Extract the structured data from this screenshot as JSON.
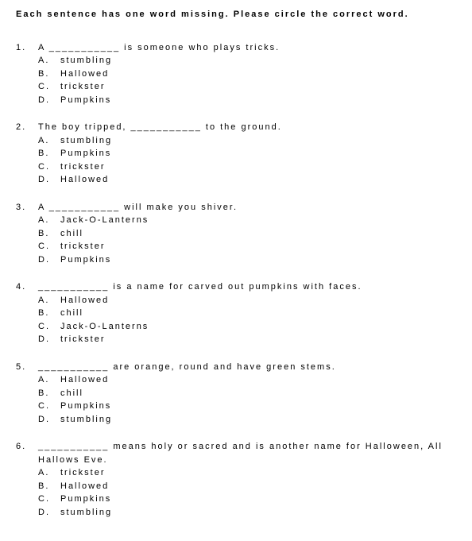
{
  "instructions": "Each sentence has one word missing.  Please circle the correct word.",
  "questions": [
    {
      "number": "1.",
      "text": "A  ___________  is someone who plays tricks.",
      "choices": [
        {
          "letter": "A.",
          "text": "stumbling"
        },
        {
          "letter": "B.",
          "text": "Hallowed"
        },
        {
          "letter": "C.",
          "text": "trickster"
        },
        {
          "letter": "D.",
          "text": "Pumpkins"
        }
      ]
    },
    {
      "number": "2.",
      "text": "The boy tripped,  ___________  to the ground.",
      "choices": [
        {
          "letter": "A.",
          "text": "stumbling"
        },
        {
          "letter": "B.",
          "text": "Pumpkins"
        },
        {
          "letter": "C.",
          "text": "trickster"
        },
        {
          "letter": "D.",
          "text": "Hallowed"
        }
      ]
    },
    {
      "number": "3.",
      "text": "A  ___________  will make you shiver.",
      "choices": [
        {
          "letter": "A.",
          "text": "Jack-O-Lanterns"
        },
        {
          "letter": "B.",
          "text": "chill"
        },
        {
          "letter": "C.",
          "text": "trickster"
        },
        {
          "letter": "D.",
          "text": "Pumpkins"
        }
      ]
    },
    {
      "number": "4.",
      "text": "___________  is a name for carved out pumpkins with faces.",
      "choices": [
        {
          "letter": "A.",
          "text": "Hallowed"
        },
        {
          "letter": "B.",
          "text": "chill"
        },
        {
          "letter": "C.",
          "text": "Jack-O-Lanterns"
        },
        {
          "letter": "D.",
          "text": "trickster"
        }
      ]
    },
    {
      "number": "5.",
      "text": "___________  are orange, round and have green stems.",
      "choices": [
        {
          "letter": "A.",
          "text": "Hallowed"
        },
        {
          "letter": "B.",
          "text": "chill"
        },
        {
          "letter": "C.",
          "text": "Pumpkins"
        },
        {
          "letter": "D.",
          "text": "stumbling"
        }
      ]
    },
    {
      "number": "6.",
      "text": "___________  means holy or sacred and is another name for Halloween, All Hallows Eve.",
      "choices": [
        {
          "letter": "A.",
          "text": "trickster"
        },
        {
          "letter": "B.",
          "text": "Hallowed"
        },
        {
          "letter": "C.",
          "text": "Pumpkins"
        },
        {
          "letter": "D.",
          "text": "stumbling"
        }
      ]
    }
  ]
}
